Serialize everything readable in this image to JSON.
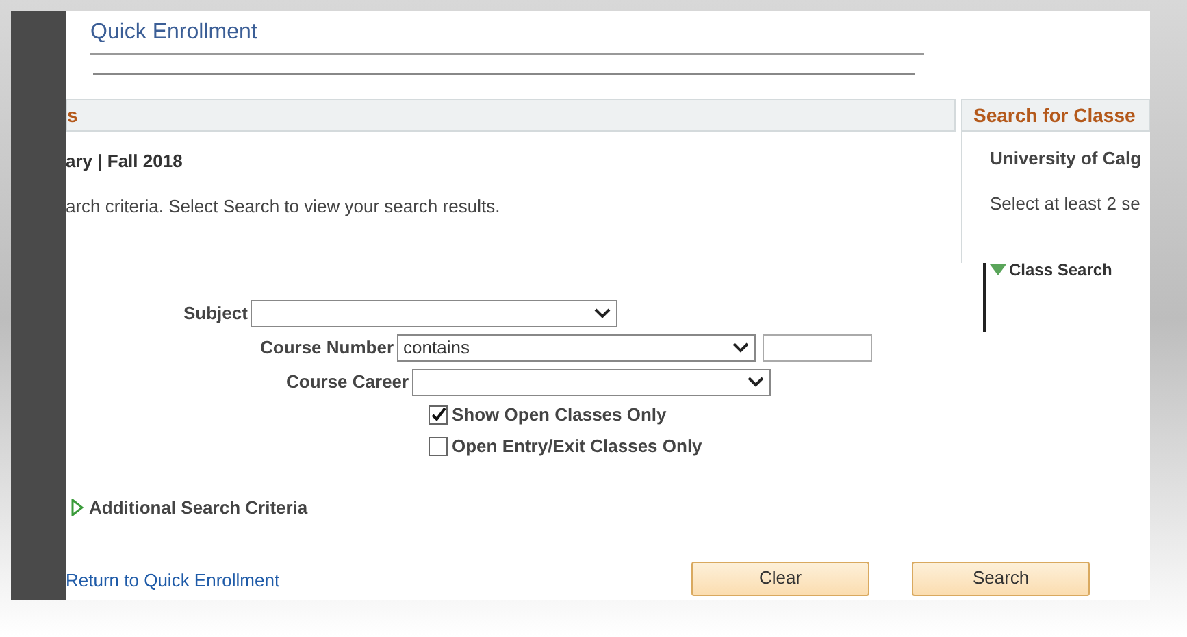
{
  "page_title": "Quick Enrollment",
  "section_header": "s",
  "term": "ary | Fall 2018",
  "instructions": "arch criteria. Select Search to view your search results.",
  "fields": [
    {
      "kind": "select",
      "label": "Subject"
    },
    {
      "kind": "select_with_input",
      "label": "Course Number",
      "value": "contains"
    },
    {
      "kind": "select",
      "label": "Course Career"
    }
  ],
  "checkboxes": [
    {
      "label": "Show Open Classes Only",
      "checked": true
    },
    {
      "label": "Open Entry/Exit Classes Only",
      "checked": false
    }
  ],
  "additional_criteria": {
    "label": "Additional Search Criteria",
    "expanded": false
  },
  "return_link": "Return to Quick Enrollment",
  "buttons": [
    "Clear",
    "Search"
  ],
  "side_panel": {
    "header": "Search for Classe",
    "institution": "University of Calg",
    "hint": "Select at least 2 se",
    "step": "Class Search"
  }
}
